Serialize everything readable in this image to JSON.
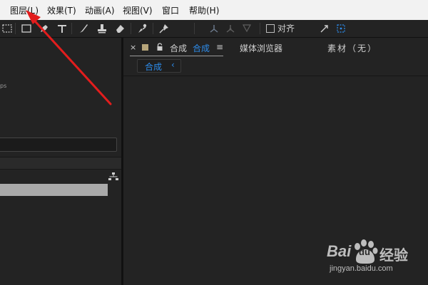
{
  "menubar": {
    "items": [
      "图层(L)",
      "效果(T)",
      "动画(A)",
      "视图(V)",
      "窗口",
      "帮助(H)"
    ]
  },
  "toolbar": {
    "snap_label": "对齐",
    "snap_checked": false
  },
  "left_panel": {
    "tiny_text": "ps"
  },
  "comp_panel": {
    "close_glyph": "×",
    "tab_prefix": "合成",
    "tab_active_name": "合成",
    "menu_glyph": "≡",
    "tab_media": "媒体浏览器",
    "tab_footage": "素材（无）",
    "breadcrumb_label": "合成",
    "breadcrumb_arrow": "‹",
    "swatch_color": "#b6a57a",
    "accent_color": "#2d8ceb"
  },
  "annotation": {
    "arrow_color": "#e21d1d"
  },
  "watermark": {
    "bai": "Bai",
    "du": "du",
    "jingyan": "经验",
    "url": "jingyan.baidu.com"
  }
}
